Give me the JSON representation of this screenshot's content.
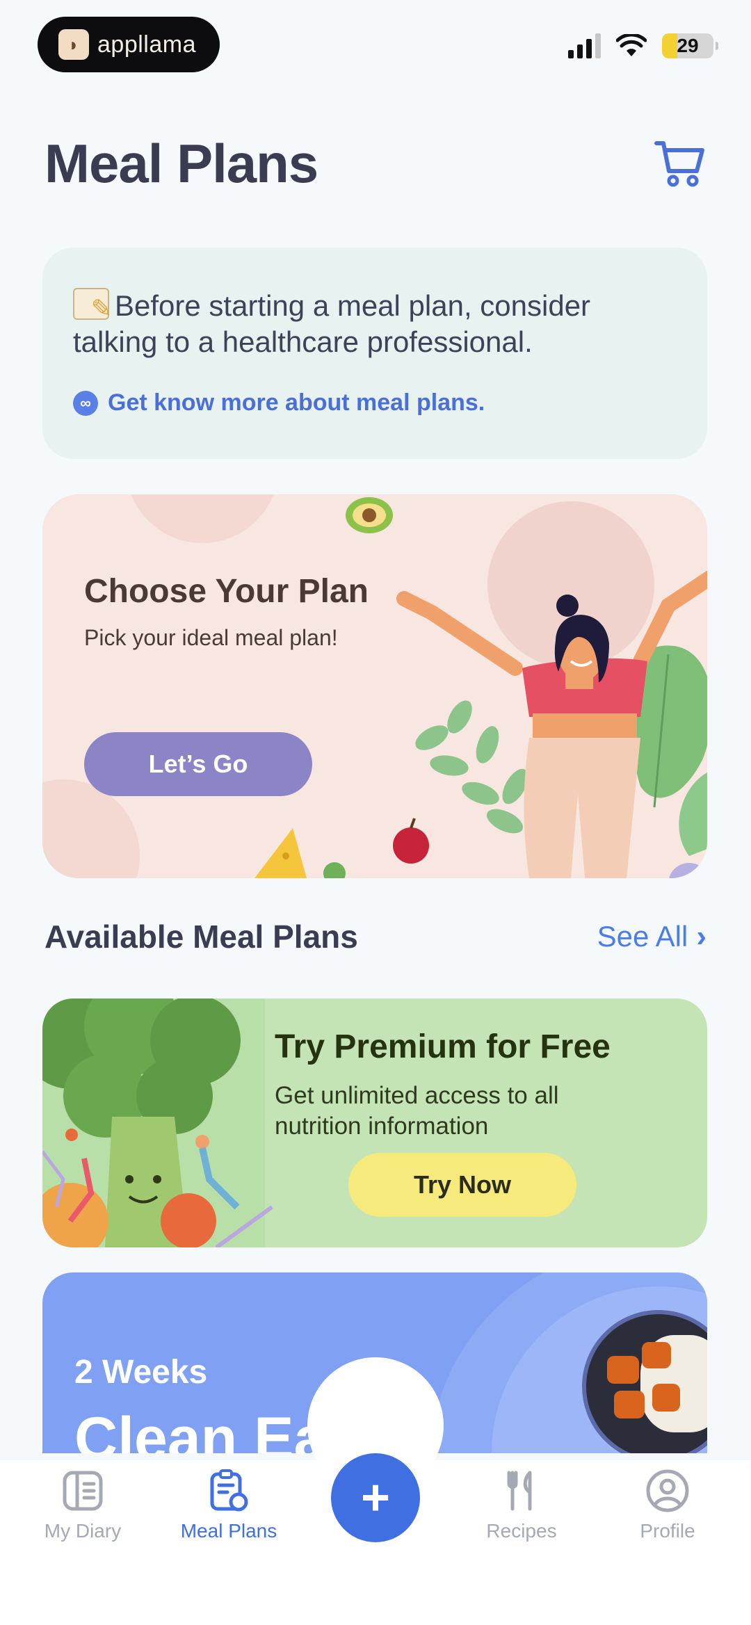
{
  "status_bar": {
    "app_name": "appllama",
    "battery": "29"
  },
  "header": {
    "title": "Meal Plans",
    "cart_icon": "cart-icon"
  },
  "notice": {
    "text": "Before starting a meal plan, consider talking to a healthcare professional.",
    "link_label": "Get know more about meal plans.",
    "link_color": "#4a6fd8"
  },
  "choose_plan": {
    "title": "Choose Your Plan",
    "subtitle": "Pick your ideal meal plan!",
    "button_label": "Let’s Go"
  },
  "available": {
    "title": "Available Meal Plans",
    "see_all_label": "See All"
  },
  "premium": {
    "title": "Try Premium for Free",
    "description": "Get unlimited access to all nutrition information",
    "button_label": "Try Now"
  },
  "clean_eating": {
    "duration": "2 Weeks",
    "title": "Clean Eating"
  },
  "bottom_nav": {
    "items": [
      {
        "label": "My Diary",
        "icon": "diary-icon"
      },
      {
        "label": "Meal Plans",
        "icon": "meal-plans-icon"
      },
      {
        "label": "Recipes",
        "icon": "recipes-icon"
      },
      {
        "label": "Profile",
        "icon": "profile-icon"
      }
    ],
    "fab_label": "+",
    "active_color": "#3f6fe0",
    "inactive_color": "#a5a9b4"
  }
}
